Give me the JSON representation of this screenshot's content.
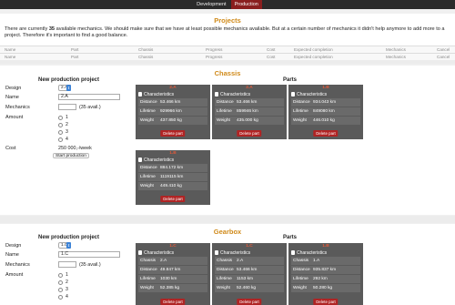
{
  "tabs": [
    "Development",
    "Production"
  ],
  "projects": {
    "title": "Projects",
    "desc_prefix": "There are currently ",
    "count": "35",
    "desc_suffix": " available mechanics. We should make sure that we have at least possible mechanics available. But at a certain number of mechanics it didn't help anymore to add more to a project. Therefore it's important to find a good balance.",
    "columns": [
      "Name",
      "Part",
      "Chassis",
      "Progress",
      "Cost",
      "Expected completion",
      "Mechanics",
      "Cancel"
    ],
    "columns2": [
      "Name",
      "Part",
      "Chassis",
      "Progress",
      "Cost",
      "Expected completion",
      "Mechanics",
      "Cancel"
    ]
  },
  "chassis": {
    "title": "Chassis",
    "new_title": "New production project",
    "parts_title": "Parts",
    "labels": {
      "design": "Design",
      "name": "Name",
      "mechanics": "Mechanics",
      "amount": "Amount",
      "cost": "Cost"
    },
    "design_value": "2.A",
    "name_value": "2.A",
    "mechanics_avail": "(35 avail.)",
    "amount_options": [
      "1",
      "2",
      "3",
      "4"
    ],
    "cost_value": "250 000,-/week",
    "start_btn": "Start production",
    "cards": [
      {
        "name": "2.A",
        "header": "Characteristics",
        "rows": [
          [
            "Distance",
            "53.466 km"
          ],
          [
            "Lifetime",
            "929966 km"
          ],
          [
            "Weight",
            "437.850 kg"
          ]
        ],
        "delete": "Delete part"
      },
      {
        "name": "2.A",
        "header": "Characteristics",
        "rows": [
          [
            "Distance",
            "53.466 km"
          ],
          [
            "Lifetime",
            "859946 km"
          ],
          [
            "Weight",
            "435.000 kg"
          ]
        ],
        "delete": "Delete part"
      },
      {
        "name": "1.B",
        "header": "Characteristics",
        "rows": [
          [
            "Distance",
            "934.043 km"
          ],
          [
            "Lifetime",
            "849080 km"
          ],
          [
            "Weight",
            "446.010 kg"
          ]
        ],
        "delete": "Delete part"
      },
      {
        "name": "1.B",
        "header": "Characteristics",
        "rows": [
          [
            "Distance",
            "884.172 km"
          ],
          [
            "Lifetime",
            "1119115 km"
          ],
          [
            "Weight",
            "449.410 kg"
          ]
        ],
        "delete": "Delete part"
      }
    ]
  },
  "gearbox": {
    "title": "Gearbox",
    "new_title": "New production project",
    "parts_title": "Parts",
    "labels": {
      "design": "Design",
      "name": "Name",
      "mechanics": "Mechanics",
      "amount": "Amount"
    },
    "design_value": "1.C",
    "name_value": "1.C",
    "mechanics_avail": "(35 avail.)",
    "amount_options": [
      "1",
      "2",
      "3",
      "4"
    ],
    "cards": [
      {
        "name": "1.C",
        "header": "Characteristics",
        "rows": [
          [
            "Chassis",
            "2.A"
          ],
          [
            "Distance",
            "49.847 km"
          ],
          [
            "Lifetime",
            "1030 km"
          ],
          [
            "Weight",
            "52.385 kg"
          ]
        ],
        "delete": "Delete part"
      },
      {
        "name": "1.C",
        "header": "Characteristics",
        "rows": [
          [
            "Chassis",
            "2.A"
          ],
          [
            "Distance",
            "53.466 km"
          ],
          [
            "Lifetime",
            "1153 km"
          ],
          [
            "Weight",
            "52.460 kg"
          ]
        ],
        "delete": "Delete part"
      },
      {
        "name": "1.B",
        "header": "Characteristics",
        "rows": [
          [
            "Chassis",
            "1.A"
          ],
          [
            "Distance",
            "935.837 km"
          ],
          [
            "Lifetime",
            "292 km"
          ],
          [
            "Weight",
            "50.280 kg"
          ]
        ],
        "delete": "Delete part"
      }
    ]
  }
}
